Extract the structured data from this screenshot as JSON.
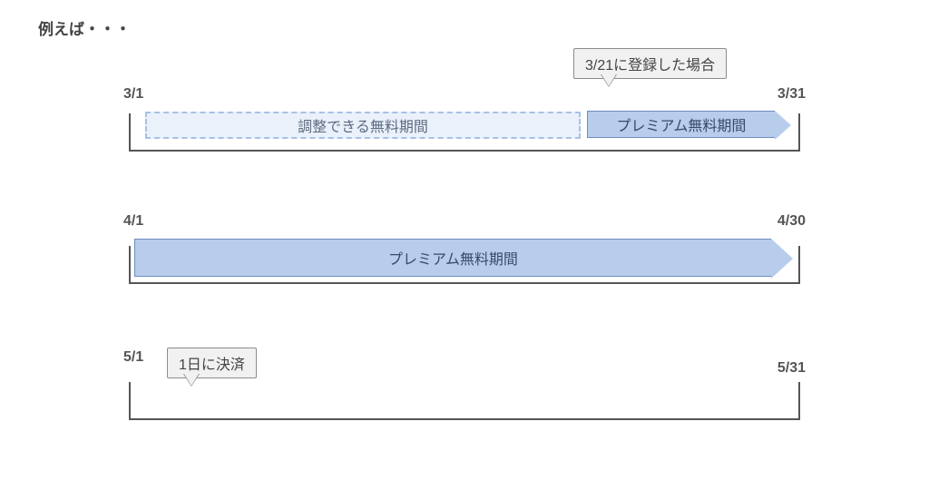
{
  "title": "例えば・・・",
  "callouts": {
    "registration": "3/21に登録した場合",
    "payment": "1日に決済"
  },
  "row1": {
    "start": "3/1",
    "end": "3/31",
    "adjustable_label": "調整できる無料期間",
    "premium_label": "プレミアム無料期間"
  },
  "row2": {
    "start": "4/1",
    "end": "4/30",
    "premium_label": "プレミアム無料期間"
  },
  "row3": {
    "start": "5/1",
    "end": "5/31"
  }
}
